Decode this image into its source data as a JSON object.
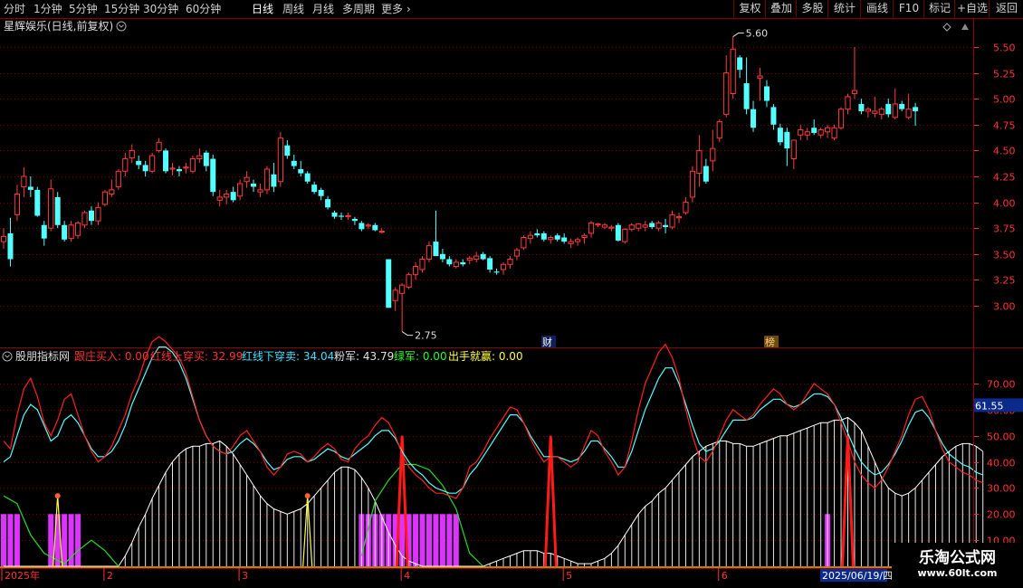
{
  "toolbar": {
    "periods": [
      {
        "label": "分时",
        "active": false
      },
      {
        "label": "1分钟",
        "active": false
      },
      {
        "label": "5分钟",
        "active": false
      },
      {
        "label": "15分钟",
        "active": false
      },
      {
        "label": "30分钟",
        "active": false
      },
      {
        "label": "60分钟",
        "active": false
      },
      {
        "label": "日线",
        "active": true
      },
      {
        "label": "周线",
        "active": false
      },
      {
        "label": "月线",
        "active": false
      },
      {
        "label": "多周期",
        "active": false
      },
      {
        "label": "更多",
        "active": false
      }
    ],
    "actions": [
      "复权",
      "叠加",
      "多股",
      "统计",
      "画线",
      "F10",
      "标记",
      "+自选",
      "返回"
    ]
  },
  "price_panel": {
    "title": "星辉娱乐(日线,前复权)",
    "high_label": "5.60",
    "low_label": "2.75",
    "marker_cai": "财",
    "marker_bang": "榜",
    "axis_ticks": [
      "5.50",
      "5.25",
      "5.00",
      "4.75",
      "4.50",
      "4.25",
      "4.00",
      "3.75",
      "3.50",
      "3.25",
      "3.00"
    ],
    "axis_values": [
      5.5,
      5.25,
      5.0,
      4.75,
      4.5,
      4.25,
      4.0,
      3.75,
      3.5,
      3.25,
      3.0
    ]
  },
  "indicator_panel": {
    "name": "股朋指标网",
    "legend": [
      {
        "label": "跟庄买入: 0.00",
        "color": "#ff3030"
      },
      {
        "label": "红线上穿买: 32.99",
        "color": "#ff3030"
      },
      {
        "label": "红线下穿卖: 34.04",
        "color": "#40e0ff"
      },
      {
        "label": "粉军: 43.79",
        "color": "#e0e0e0"
      },
      {
        "label": "绿军: 0.00",
        "color": "#22ff22"
      },
      {
        "label": "出手就赢: 0.00",
        "color": "#ffff40"
      }
    ],
    "axis_ticks": [
      "70.00",
      "60.00",
      "50.00",
      "40.00",
      "30.00",
      "20.00",
      "10.00"
    ],
    "axis_values": [
      70,
      60,
      50,
      40,
      30,
      20,
      10
    ],
    "current_badge": "61.55"
  },
  "date_axis": {
    "labels": [
      {
        "text": "2025年"
      },
      {
        "text": "2"
      },
      {
        "text": "3"
      },
      {
        "text": "4"
      },
      {
        "text": "5"
      },
      {
        "text": "6"
      }
    ],
    "cursor_date": "2025/06/19/四"
  },
  "watermark": {
    "title": "乐淘公式网",
    "url": "www.60lt.com"
  },
  "colors": {
    "up": "#ff3b3b",
    "down": "#54ffff",
    "grid": "#7a0000",
    "axis_text": "#ff3333",
    "pink": "#dd33ff",
    "green": "#22dd22",
    "yellow": "#ffff40"
  },
  "chart_data": {
    "type": "candlestick",
    "ohlc": [
      [
        3.62,
        3.75,
        3.55,
        3.67
      ],
      [
        3.7,
        3.85,
        3.38,
        3.45
      ],
      [
        3.88,
        4.17,
        3.82,
        4.08
      ],
      [
        4.15,
        4.34,
        4.05,
        4.25
      ],
      [
        4.15,
        4.25,
        4.05,
        4.12
      ],
      [
        4.12,
        4.15,
        3.86,
        3.87
      ],
      [
        3.78,
        3.82,
        3.58,
        3.65
      ],
      [
        3.75,
        4.22,
        3.72,
        4.13
      ],
      [
        4.05,
        4.1,
        3.75,
        3.78
      ],
      [
        3.78,
        3.82,
        3.62,
        3.64
      ],
      [
        3.65,
        3.82,
        3.62,
        3.78
      ],
      [
        3.68,
        3.82,
        3.65,
        3.8
      ],
      [
        3.78,
        3.92,
        3.75,
        3.9
      ],
      [
        3.92,
        3.96,
        3.78,
        3.82
      ],
      [
        3.82,
        4.0,
        3.78,
        3.95
      ],
      [
        3.98,
        4.12,
        3.96,
        4.1
      ],
      [
        4.08,
        4.22,
        4.05,
        4.12
      ],
      [
        4.15,
        4.32,
        4.12,
        4.3
      ],
      [
        4.3,
        4.48,
        4.25,
        4.42
      ],
      [
        4.43,
        4.56,
        4.38,
        4.5
      ],
      [
        4.4,
        4.45,
        4.32,
        4.36
      ],
      [
        4.36,
        4.4,
        4.25,
        4.3
      ],
      [
        4.3,
        4.48,
        4.28,
        4.45
      ],
      [
        4.5,
        4.62,
        4.48,
        4.58
      ],
      [
        4.5,
        4.52,
        4.28,
        4.3
      ],
      [
        4.32,
        4.38,
        4.26,
        4.33
      ],
      [
        4.32,
        4.35,
        4.25,
        4.3
      ],
      [
        4.33,
        4.38,
        4.28,
        4.34
      ],
      [
        4.3,
        4.45,
        4.28,
        4.42
      ],
      [
        4.42,
        4.52,
        4.38,
        4.45
      ],
      [
        4.48,
        4.5,
        4.3,
        4.35
      ],
      [
        4.42,
        4.46,
        4.06,
        4.1
      ],
      [
        4.02,
        4.12,
        3.96,
        4.05
      ],
      [
        4.05,
        4.12,
        3.98,
        4.08
      ],
      [
        4.1,
        4.15,
        4.0,
        4.02
      ],
      [
        4.06,
        4.22,
        4.02,
        4.18
      ],
      [
        4.2,
        4.3,
        4.14,
        4.24
      ],
      [
        4.18,
        4.22,
        4.1,
        4.15
      ],
      [
        4.1,
        4.18,
        4.05,
        4.12
      ],
      [
        4.12,
        4.35,
        4.08,
        4.32
      ],
      [
        4.27,
        4.38,
        4.1,
        4.15
      ],
      [
        4.2,
        4.68,
        4.15,
        4.62
      ],
      [
        4.55,
        4.6,
        4.42,
        4.45
      ],
      [
        4.4,
        4.46,
        4.32,
        4.35
      ],
      [
        4.32,
        4.4,
        4.25,
        4.28
      ],
      [
        4.28,
        4.3,
        4.18,
        4.2
      ],
      [
        4.17,
        4.2,
        4.08,
        4.1
      ],
      [
        4.12,
        4.14,
        4.02,
        4.06
      ],
      [
        4.03,
        4.06,
        3.93,
        3.95
      ],
      [
        3.9,
        3.92,
        3.84,
        3.86
      ],
      [
        3.87,
        3.9,
        3.83,
        3.86
      ],
      [
        3.86,
        3.9,
        3.83,
        3.87
      ],
      [
        3.84,
        3.86,
        3.78,
        3.82
      ],
      [
        3.8,
        3.82,
        3.72,
        3.74
      ],
      [
        3.77,
        3.8,
        3.74,
        3.78
      ],
      [
        3.78,
        3.8,
        3.72,
        3.73
      ],
      [
        3.72,
        3.75,
        3.7,
        3.72
      ],
      [
        3.45,
        3.45,
        2.98,
        2.98
      ],
      [
        3.05,
        3.18,
        2.95,
        3.15
      ],
      [
        3.12,
        3.22,
        2.75,
        3.2
      ],
      [
        3.18,
        3.32,
        3.16,
        3.3
      ],
      [
        3.3,
        3.42,
        3.25,
        3.38
      ],
      [
        3.35,
        3.48,
        3.32,
        3.45
      ],
      [
        3.45,
        3.62,
        3.42,
        3.58
      ],
      [
        3.62,
        3.92,
        3.6,
        3.48
      ],
      [
        3.5,
        3.55,
        3.42,
        3.45
      ],
      [
        3.45,
        3.48,
        3.38,
        3.4
      ],
      [
        3.38,
        3.45,
        3.36,
        3.42
      ],
      [
        3.42,
        3.45,
        3.38,
        3.4
      ],
      [
        3.44,
        3.48,
        3.4,
        3.46
      ],
      [
        3.45,
        3.52,
        3.42,
        3.48
      ],
      [
        3.5,
        3.52,
        3.44,
        3.45
      ],
      [
        3.46,
        3.48,
        3.32,
        3.35
      ],
      [
        3.33,
        3.36,
        3.3,
        3.32
      ],
      [
        3.35,
        3.42,
        3.3,
        3.4
      ],
      [
        3.4,
        3.48,
        3.36,
        3.45
      ],
      [
        3.48,
        3.56,
        3.44,
        3.54
      ],
      [
        3.56,
        3.68,
        3.54,
        3.66
      ],
      [
        3.65,
        3.72,
        3.6,
        3.68
      ],
      [
        3.7,
        3.74,
        3.66,
        3.68
      ],
      [
        3.7,
        3.72,
        3.62,
        3.64
      ],
      [
        3.64,
        3.68,
        3.6,
        3.66
      ],
      [
        3.68,
        3.7,
        3.62,
        3.64
      ],
      [
        3.66,
        3.7,
        3.6,
        3.62
      ],
      [
        3.6,
        3.65,
        3.56,
        3.62
      ],
      [
        3.62,
        3.66,
        3.58,
        3.64
      ],
      [
        3.66,
        3.7,
        3.6,
        3.68
      ],
      [
        3.7,
        3.82,
        3.66,
        3.8
      ],
      [
        3.78,
        3.8,
        3.76,
        3.79
      ],
      [
        3.76,
        3.8,
        3.74,
        3.78
      ],
      [
        3.75,
        3.78,
        3.72,
        3.76
      ],
      [
        3.78,
        3.8,
        3.62,
        3.63
      ],
      [
        3.62,
        3.75,
        3.6,
        3.74
      ],
      [
        3.74,
        3.8,
        3.72,
        3.78
      ],
      [
        3.75,
        3.8,
        3.72,
        3.79
      ],
      [
        3.76,
        3.82,
        3.72,
        3.78
      ],
      [
        3.8,
        3.82,
        3.74,
        3.76
      ],
      [
        3.75,
        3.82,
        3.72,
        3.8
      ],
      [
        3.78,
        3.84,
        3.7,
        3.76
      ],
      [
        3.76,
        3.92,
        3.74,
        3.88
      ],
      [
        3.85,
        3.9,
        3.8,
        3.86
      ],
      [
        3.9,
        4.05,
        3.88,
        4.0
      ],
      [
        4.05,
        4.35,
        4.0,
        4.3
      ],
      [
        4.28,
        4.65,
        4.15,
        4.5
      ],
      [
        4.35,
        4.42,
        4.18,
        4.2
      ],
      [
        4.4,
        4.7,
        4.3,
        4.52
      ],
      [
        4.62,
        4.8,
        4.58,
        4.78
      ],
      [
        4.85,
        5.42,
        4.82,
        5.25
      ],
      [
        5.05,
        5.6,
        5.0,
        5.48
      ],
      [
        5.4,
        5.42,
        5.2,
        5.28
      ],
      [
        5.15,
        5.4,
        4.85,
        4.9
      ],
      [
        4.9,
        4.98,
        4.68,
        4.72
      ],
      [
        5.2,
        5.3,
        4.98,
        5.22
      ],
      [
        5.12,
        5.18,
        4.92,
        4.98
      ],
      [
        4.92,
        4.95,
        4.7,
        4.75
      ],
      [
        4.72,
        4.76,
        4.55,
        4.58
      ],
      [
        4.68,
        4.72,
        4.35,
        4.52
      ],
      [
        4.42,
        4.58,
        4.32,
        4.6
      ],
      [
        4.65,
        4.75,
        4.6,
        4.7
      ],
      [
        4.65,
        4.72,
        4.6,
        4.68
      ],
      [
        4.72,
        4.8,
        4.65,
        4.67
      ],
      [
        4.65,
        4.72,
        4.62,
        4.7
      ],
      [
        4.68,
        4.75,
        4.62,
        4.72
      ],
      [
        4.62,
        4.75,
        4.6,
        4.72
      ],
      [
        4.72,
        4.92,
        4.7,
        4.9
      ],
      [
        4.9,
        5.05,
        4.85,
        5.02
      ],
      [
        5.05,
        5.5,
        5.0,
        5.08
      ],
      [
        4.95,
        5.0,
        4.85,
        4.88
      ],
      [
        4.88,
        4.92,
        4.82,
        4.9
      ],
      [
        4.86,
        5.02,
        4.82,
        4.88
      ],
      [
        4.85,
        4.92,
        4.8,
        4.9
      ],
      [
        4.95,
        5.0,
        4.82,
        4.85
      ],
      [
        4.82,
        5.1,
        4.8,
        4.95
      ],
      [
        4.95,
        4.98,
        4.88,
        4.9
      ],
      [
        4.82,
        5.05,
        4.8,
        4.9
      ],
      [
        4.92,
        4.96,
        4.74,
        4.88
      ]
    ],
    "indicator": {
      "red": [
        48,
        45,
        58,
        68,
        72,
        65,
        55,
        50,
        56,
        64,
        66,
        58,
        50,
        44,
        40,
        42,
        46,
        52,
        58,
        66,
        72,
        80,
        86,
        88,
        86,
        83,
        80,
        74,
        65,
        56,
        50,
        46,
        44,
        43,
        46,
        50,
        52,
        48,
        44,
        38,
        35,
        38,
        43,
        44,
        43,
        40,
        42,
        45,
        47,
        45,
        41,
        40,
        45,
        48,
        50,
        54,
        57,
        55,
        50,
        43,
        38,
        35,
        33,
        30,
        28,
        28,
        27,
        26,
        30,
        38,
        40,
        44,
        49,
        53,
        57,
        61,
        60,
        55,
        49,
        44,
        40,
        42,
        42,
        40,
        38,
        40,
        46,
        52,
        50,
        44,
        40,
        35,
        38,
        48,
        60,
        70,
        76,
        82,
        85,
        80,
        72,
        60,
        50,
        42,
        40,
        44,
        50,
        56,
        60,
        58,
        56,
        58,
        62,
        65,
        68,
        66,
        62,
        60,
        62,
        66,
        70,
        68,
        66,
        62,
        55,
        48,
        40,
        35,
        32,
        30,
        33,
        38,
        44,
        50,
        58,
        64,
        65,
        60,
        52,
        45,
        40,
        38,
        36,
        35,
        33,
        32
      ],
      "cyan": [
        40,
        42,
        50,
        58,
        62,
        60,
        54,
        48,
        50,
        56,
        58,
        55,
        50,
        45,
        42,
        42,
        44,
        48,
        54,
        62,
        68,
        74,
        80,
        84,
        84,
        82,
        78,
        72,
        64,
        56,
        50,
        46,
        44,
        43,
        44,
        47,
        49,
        47,
        44,
        40,
        37,
        38,
        41,
        42,
        42,
        40,
        41,
        43,
        45,
        44,
        42,
        41,
        43,
        45,
        47,
        50,
        52,
        52,
        49,
        44,
        40,
        37,
        35,
        32,
        30,
        29,
        28,
        28,
        30,
        35,
        38,
        42,
        46,
        50,
        54,
        58,
        58,
        55,
        50,
        46,
        42,
        42,
        42,
        41,
        40,
        41,
        44,
        48,
        48,
        45,
        42,
        38,
        38,
        44,
        52,
        60,
        66,
        72,
        76,
        76,
        70,
        62,
        54,
        47,
        44,
        45,
        48,
        52,
        56,
        56,
        56,
        57,
        60,
        62,
        64,
        64,
        62,
        61,
        62,
        64,
        66,
        66,
        65,
        62,
        57,
        51,
        45,
        40,
        37,
        35,
        36,
        39,
        43,
        48,
        54,
        59,
        60,
        57,
        52,
        47,
        43,
        41,
        39,
        38,
        36,
        35
      ],
      "white": [
        0,
        0,
        0,
        0,
        0,
        0,
        0,
        0,
        0,
        0,
        0,
        0,
        0,
        0,
        0,
        0,
        0,
        0,
        4,
        9,
        15,
        20,
        26,
        31,
        36,
        40,
        43,
        45,
        46,
        46,
        47,
        47,
        48,
        46,
        43,
        39,
        35,
        31,
        27,
        24,
        22,
        21,
        20,
        21,
        22,
        24,
        27,
        30,
        33,
        36,
        38,
        38,
        37,
        34,
        30,
        25,
        19,
        13,
        8,
        4,
        2,
        1,
        0,
        0,
        0,
        0,
        0,
        0,
        0,
        0,
        0,
        0,
        1,
        2,
        3,
        4,
        5,
        6,
        6,
        6,
        5,
        5,
        4,
        3,
        2,
        1,
        1,
        1,
        2,
        3,
        5,
        8,
        12,
        16,
        20,
        23,
        25,
        28,
        30,
        33,
        36,
        39,
        42,
        44,
        46,
        47,
        48,
        48,
        47,
        47,
        46,
        46,
        47,
        48,
        49,
        50,
        50,
        51,
        52,
        53,
        54,
        55,
        55,
        56,
        56,
        57,
        55,
        52,
        46,
        40,
        34,
        30,
        28,
        27,
        28,
        30,
        33,
        36,
        39,
        42,
        44,
        46,
        47,
        47,
        46,
        44
      ]
    }
  }
}
